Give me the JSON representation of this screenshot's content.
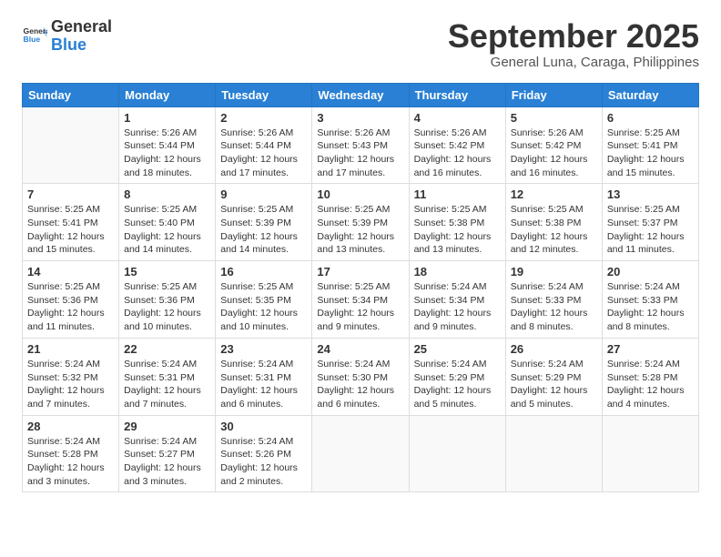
{
  "header": {
    "logo_general": "General",
    "logo_blue": "Blue",
    "month": "September 2025",
    "location": "General Luna, Caraga, Philippines"
  },
  "days_of_week": [
    "Sunday",
    "Monday",
    "Tuesday",
    "Wednesday",
    "Thursday",
    "Friday",
    "Saturday"
  ],
  "weeks": [
    [
      {
        "day": null,
        "info": null
      },
      {
        "day": "1",
        "info": "Sunrise: 5:26 AM\nSunset: 5:44 PM\nDaylight: 12 hours\nand 18 minutes."
      },
      {
        "day": "2",
        "info": "Sunrise: 5:26 AM\nSunset: 5:44 PM\nDaylight: 12 hours\nand 17 minutes."
      },
      {
        "day": "3",
        "info": "Sunrise: 5:26 AM\nSunset: 5:43 PM\nDaylight: 12 hours\nand 17 minutes."
      },
      {
        "day": "4",
        "info": "Sunrise: 5:26 AM\nSunset: 5:42 PM\nDaylight: 12 hours\nand 16 minutes."
      },
      {
        "day": "5",
        "info": "Sunrise: 5:26 AM\nSunset: 5:42 PM\nDaylight: 12 hours\nand 16 minutes."
      },
      {
        "day": "6",
        "info": "Sunrise: 5:25 AM\nSunset: 5:41 PM\nDaylight: 12 hours\nand 15 minutes."
      }
    ],
    [
      {
        "day": "7",
        "info": "Sunrise: 5:25 AM\nSunset: 5:41 PM\nDaylight: 12 hours\nand 15 minutes."
      },
      {
        "day": "8",
        "info": "Sunrise: 5:25 AM\nSunset: 5:40 PM\nDaylight: 12 hours\nand 14 minutes."
      },
      {
        "day": "9",
        "info": "Sunrise: 5:25 AM\nSunset: 5:39 PM\nDaylight: 12 hours\nand 14 minutes."
      },
      {
        "day": "10",
        "info": "Sunrise: 5:25 AM\nSunset: 5:39 PM\nDaylight: 12 hours\nand 13 minutes."
      },
      {
        "day": "11",
        "info": "Sunrise: 5:25 AM\nSunset: 5:38 PM\nDaylight: 12 hours\nand 13 minutes."
      },
      {
        "day": "12",
        "info": "Sunrise: 5:25 AM\nSunset: 5:38 PM\nDaylight: 12 hours\nand 12 minutes."
      },
      {
        "day": "13",
        "info": "Sunrise: 5:25 AM\nSunset: 5:37 PM\nDaylight: 12 hours\nand 11 minutes."
      }
    ],
    [
      {
        "day": "14",
        "info": "Sunrise: 5:25 AM\nSunset: 5:36 PM\nDaylight: 12 hours\nand 11 minutes."
      },
      {
        "day": "15",
        "info": "Sunrise: 5:25 AM\nSunset: 5:36 PM\nDaylight: 12 hours\nand 10 minutes."
      },
      {
        "day": "16",
        "info": "Sunrise: 5:25 AM\nSunset: 5:35 PM\nDaylight: 12 hours\nand 10 minutes."
      },
      {
        "day": "17",
        "info": "Sunrise: 5:25 AM\nSunset: 5:34 PM\nDaylight: 12 hours\nand 9 minutes."
      },
      {
        "day": "18",
        "info": "Sunrise: 5:24 AM\nSunset: 5:34 PM\nDaylight: 12 hours\nand 9 minutes."
      },
      {
        "day": "19",
        "info": "Sunrise: 5:24 AM\nSunset: 5:33 PM\nDaylight: 12 hours\nand 8 minutes."
      },
      {
        "day": "20",
        "info": "Sunrise: 5:24 AM\nSunset: 5:33 PM\nDaylight: 12 hours\nand 8 minutes."
      }
    ],
    [
      {
        "day": "21",
        "info": "Sunrise: 5:24 AM\nSunset: 5:32 PM\nDaylight: 12 hours\nand 7 minutes."
      },
      {
        "day": "22",
        "info": "Sunrise: 5:24 AM\nSunset: 5:31 PM\nDaylight: 12 hours\nand 7 minutes."
      },
      {
        "day": "23",
        "info": "Sunrise: 5:24 AM\nSunset: 5:31 PM\nDaylight: 12 hours\nand 6 minutes."
      },
      {
        "day": "24",
        "info": "Sunrise: 5:24 AM\nSunset: 5:30 PM\nDaylight: 12 hours\nand 6 minutes."
      },
      {
        "day": "25",
        "info": "Sunrise: 5:24 AM\nSunset: 5:29 PM\nDaylight: 12 hours\nand 5 minutes."
      },
      {
        "day": "26",
        "info": "Sunrise: 5:24 AM\nSunset: 5:29 PM\nDaylight: 12 hours\nand 5 minutes."
      },
      {
        "day": "27",
        "info": "Sunrise: 5:24 AM\nSunset: 5:28 PM\nDaylight: 12 hours\nand 4 minutes."
      }
    ],
    [
      {
        "day": "28",
        "info": "Sunrise: 5:24 AM\nSunset: 5:28 PM\nDaylight: 12 hours\nand 3 minutes."
      },
      {
        "day": "29",
        "info": "Sunrise: 5:24 AM\nSunset: 5:27 PM\nDaylight: 12 hours\nand 3 minutes."
      },
      {
        "day": "30",
        "info": "Sunrise: 5:24 AM\nSunset: 5:26 PM\nDaylight: 12 hours\nand 2 minutes."
      },
      {
        "day": null,
        "info": null
      },
      {
        "day": null,
        "info": null
      },
      {
        "day": null,
        "info": null
      },
      {
        "day": null,
        "info": null
      }
    ]
  ]
}
